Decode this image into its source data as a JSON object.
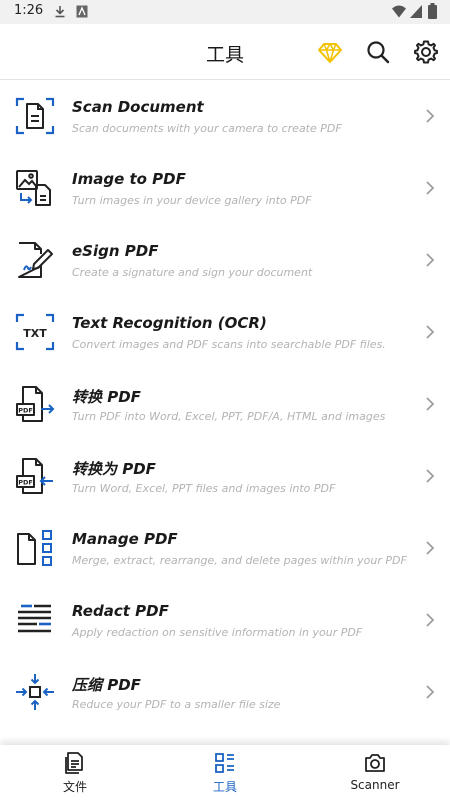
{
  "status_bar": {
    "time": "1:26"
  },
  "app_bar": {
    "title": "工具"
  },
  "colors": {
    "accent": "#1a63c4",
    "premium": "#f2c200",
    "description": "#b3b3b3",
    "divider": "#e4e4e4"
  },
  "tools": [
    {
      "icon": "scan-document-icon",
      "title": "Scan Document",
      "description": "Scan documents with your camera to create PDF"
    },
    {
      "icon": "image-to-pdf-icon",
      "title": "Image to PDF",
      "description": "Turn images in your device gallery into PDF"
    },
    {
      "icon": "esign-icon",
      "title": "eSign PDF",
      "description": "Create a signature and sign your document"
    },
    {
      "icon": "ocr-txt-icon",
      "title": "Text Recognition (OCR)",
      "description": "Convert images and PDF scans into searchable PDF files."
    },
    {
      "icon": "convert-from-pdf-icon",
      "title": "转换 PDF",
      "description": "Turn PDF into Word, Excel, PPT, PDF/A, HTML and images"
    },
    {
      "icon": "convert-to-pdf-icon",
      "title": "转换为 PDF",
      "description": "Turn Word, Excel, PPT files and images into PDF"
    },
    {
      "icon": "manage-pdf-icon",
      "title": "Manage PDF",
      "description": "Merge, extract, rearrange, and delete pages within your PDF"
    },
    {
      "icon": "redact-icon",
      "title": "Redact PDF",
      "description": "Apply redaction on sensitive information in your PDF"
    },
    {
      "icon": "compress-icon",
      "title": "压缩 PDF",
      "description": "Reduce your PDF to a smaller file size"
    }
  ],
  "bottom_nav": [
    {
      "icon": "files-icon",
      "label": "文件",
      "active": false
    },
    {
      "icon": "tools-icon",
      "label": "工具",
      "active": true
    },
    {
      "icon": "camera-icon",
      "label": "Scanner",
      "active": false
    }
  ]
}
